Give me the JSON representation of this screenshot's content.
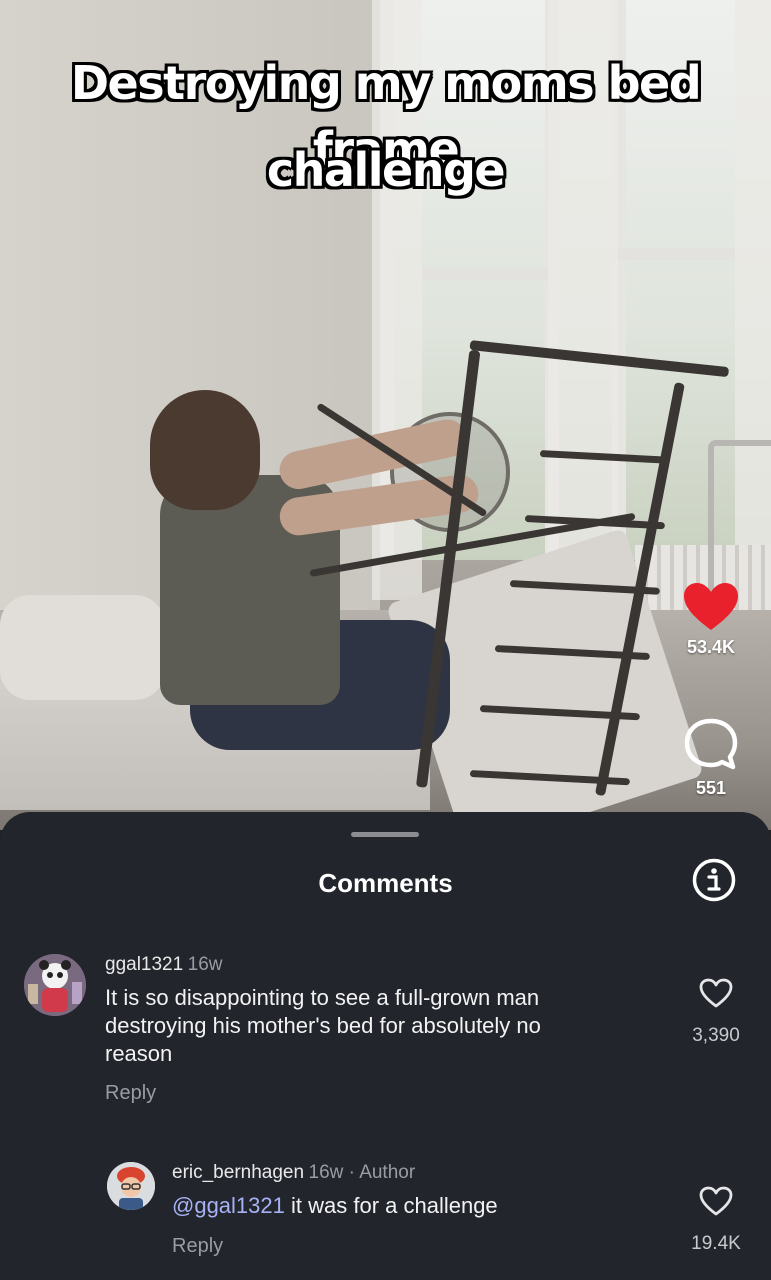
{
  "video": {
    "caption_line1": "Destroying my moms bed frame",
    "caption_line2": "challenge",
    "likes_count": "53.4K",
    "comments_count": "551",
    "heart_color": "#e8212c"
  },
  "comments_sheet": {
    "title": "Comments",
    "comments": [
      {
        "username": "ggal1321",
        "time": "16w",
        "text": "It is so disappointing to see a full-grown man destroying his mother's bed for absolutely no reason",
        "text_lines": [
          "It is so disappointing to see a full-grown man",
          "destroying his mother's bed for absolutely no",
          "reason"
        ],
        "reply_label": "Reply",
        "like_count": "3,390"
      },
      {
        "username": "eric_bernhagen",
        "time": "16w · Author",
        "mention": "@ggal1321",
        "text": "it was for a challenge",
        "reply_label": "Reply",
        "like_count": "19.4K"
      }
    ]
  }
}
